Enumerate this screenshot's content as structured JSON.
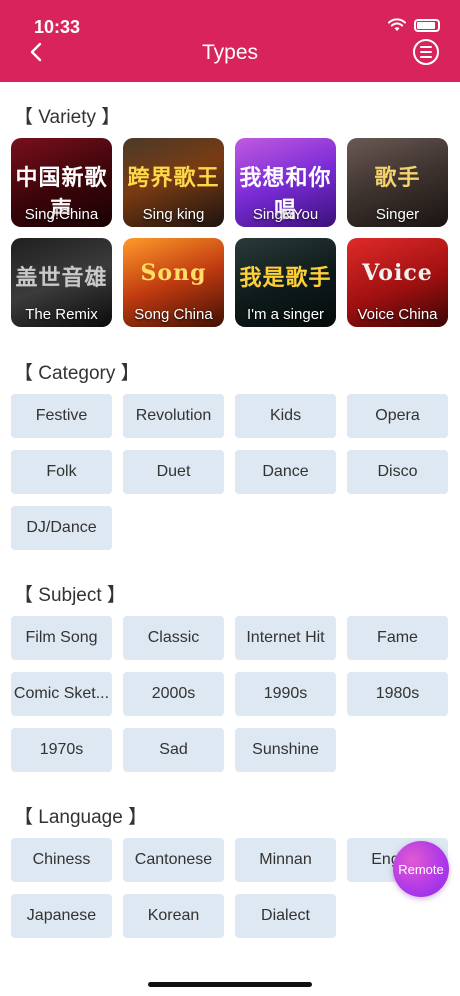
{
  "status_bar": {
    "time": "10:33"
  },
  "nav": {
    "title": "Types"
  },
  "sections": {
    "variety": "【 Variety 】",
    "category": "【 Category 】",
    "subject": "【 Subject 】",
    "language": "【 Language 】"
  },
  "variety": [
    {
      "label": "Sing!China",
      "art": "中国新歌声",
      "art_color": "#ffffff"
    },
    {
      "label": "Sing king",
      "art": "跨界歌王",
      "art_color": "#ffd84a"
    },
    {
      "label": "Sing&You",
      "art": "我想和你唱",
      "art_color": "#ffffff"
    },
    {
      "label": "Singer",
      "art": "歌手",
      "art_color": "#f5d36a"
    },
    {
      "label": "The Remix",
      "art": "盖世音雄",
      "art_color": "#c9c9c9"
    },
    {
      "label": "Song China",
      "art": "Song",
      "art_color": "#ffe066"
    },
    {
      "label": "I'm a singer",
      "art": "我是歌手",
      "art_color": "#ffcf3a"
    },
    {
      "label": "Voice China",
      "art": "Voice",
      "art_color": "#f2f2f2"
    }
  ],
  "category": [
    "Festive",
    "Revolution",
    "Kids",
    "Opera",
    "Folk",
    "Duet",
    "Dance",
    "Disco",
    "DJ/Dance"
  ],
  "subject": [
    "Film Song",
    "Classic",
    "Internet Hit",
    "Fame",
    "Comic Sket...",
    "2000s",
    "1990s",
    "1980s",
    "1970s",
    "Sad",
    "Sunshine"
  ],
  "language": [
    "Chiness",
    "Cantonese",
    "Minnan",
    "English",
    "Japanese",
    "Korean",
    "Dialect"
  ],
  "remote_label": "Remote",
  "colors": {
    "header": "#d8245a",
    "chip": "#dde8f2",
    "remote": "#b23ae8"
  }
}
